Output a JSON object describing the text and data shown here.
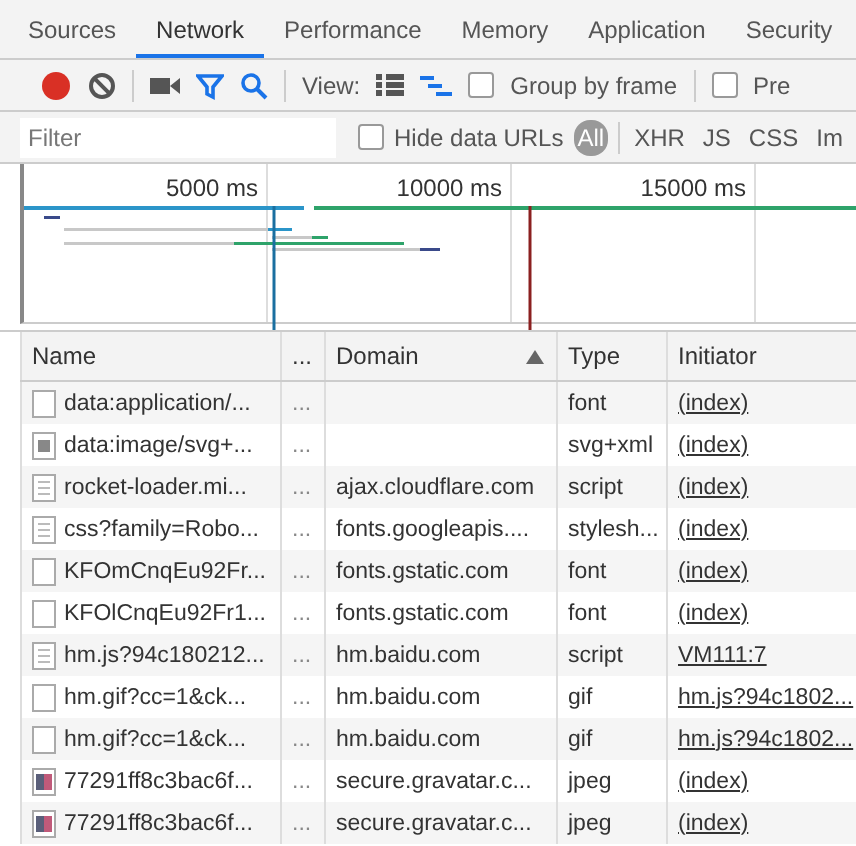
{
  "tabs": [
    {
      "label": "Sources",
      "selected": false
    },
    {
      "label": "Network",
      "selected": true
    },
    {
      "label": "Performance",
      "selected": false
    },
    {
      "label": "Memory",
      "selected": false
    },
    {
      "label": "Application",
      "selected": false
    },
    {
      "label": "Security",
      "selected": false
    }
  ],
  "toolbar": {
    "recording": true,
    "filter_active": true,
    "view_label": "View:",
    "large_rows": false,
    "waterfall_view": true,
    "checkboxes": [
      {
        "label": "Group by frame",
        "checked": false
      },
      {
        "label": "Pre",
        "checked": false
      }
    ]
  },
  "filter_bar": {
    "placeholder": "Filter",
    "hide_data_urls": {
      "label": "Hide data URLs",
      "checked": false
    },
    "types": [
      {
        "label": "All",
        "selected": true
      },
      {
        "label": "XHR",
        "selected": false
      },
      {
        "label": "JS",
        "selected": false
      },
      {
        "label": "CSS",
        "selected": false
      },
      {
        "label": "Im",
        "selected": false
      }
    ]
  },
  "overview": {
    "ticks": [
      "5000 ms",
      "10000 ms",
      "15000 ms"
    ]
  },
  "table": {
    "columns": [
      {
        "label": "Name",
        "sorted": false
      },
      {
        "label": "...",
        "sorted": false
      },
      {
        "label": "Domain",
        "sorted": true
      },
      {
        "label": "Type",
        "sorted": false
      },
      {
        "label": "Initiator",
        "sorted": false
      }
    ],
    "rows": [
      {
        "kind": "blank",
        "name": "data:application/...",
        "more": "...",
        "domain": "",
        "type": "font",
        "initiator": "(index)"
      },
      {
        "kind": "image",
        "name": "data:image/svg+...",
        "more": "...",
        "domain": "",
        "type": "svg+xml",
        "initiator": "(index)"
      },
      {
        "kind": "text",
        "name": "rocket-loader.mi...",
        "more": "...",
        "domain": "ajax.cloudflare.com",
        "type": "script",
        "initiator": "(index)"
      },
      {
        "kind": "text",
        "name": "css?family=Robo...",
        "more": "...",
        "domain": "fonts.googleapis....",
        "type": "stylesh...",
        "initiator": "(index)"
      },
      {
        "kind": "blank",
        "name": "KFOmCnqEu92Fr...",
        "more": "...",
        "domain": "fonts.gstatic.com",
        "type": "font",
        "initiator": "(index)"
      },
      {
        "kind": "blank",
        "name": "KFOlCnqEu92Fr1...",
        "more": "...",
        "domain": "fonts.gstatic.com",
        "type": "font",
        "initiator": "(index)"
      },
      {
        "kind": "text",
        "name": "hm.js?94c180212...",
        "more": "...",
        "domain": "hm.baidu.com",
        "type": "script",
        "initiator": "VM111:7"
      },
      {
        "kind": "blank",
        "name": "hm.gif?cc=1&ck...",
        "more": "...",
        "domain": "hm.baidu.com",
        "type": "gif",
        "initiator": "hm.js?94c1802..."
      },
      {
        "kind": "blank",
        "name": "hm.gif?cc=1&ck...",
        "more": "...",
        "domain": "hm.baidu.com",
        "type": "gif",
        "initiator": "hm.js?94c1802..."
      },
      {
        "kind": "photo",
        "name": "77291ff8c3bac6f...",
        "more": "...",
        "domain": "secure.gravatar.c...",
        "type": "jpeg",
        "initiator": "(index)"
      },
      {
        "kind": "photo",
        "name": "77291ff8c3bac6f...",
        "more": "...",
        "domain": "secure.gravatar.c...",
        "type": "jpeg",
        "initiator": "(index)"
      }
    ]
  }
}
